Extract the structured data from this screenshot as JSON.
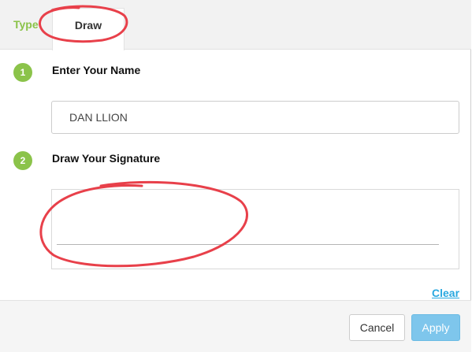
{
  "tabs": {
    "type_label": "Type",
    "draw_label": "Draw",
    "active": "Draw"
  },
  "steps": [
    {
      "number": "1",
      "label": "Enter Your Name"
    },
    {
      "number": "2",
      "label": "Draw Your Signature"
    }
  ],
  "name_input": {
    "value": "DAN LLION"
  },
  "clear_label": "Clear",
  "footer": {
    "cancel_label": "Cancel",
    "apply_label": "Apply"
  },
  "colors": {
    "accent_green": "#8bc34a",
    "link_blue": "#29a8e0",
    "apply_blue": "#7ec6ec",
    "annotation_red": "#e8404a"
  },
  "annotations": [
    {
      "type": "hand-drawn-circle",
      "target": "tab-draw"
    },
    {
      "type": "hand-drawn-circle",
      "target": "signature-pad"
    }
  ]
}
